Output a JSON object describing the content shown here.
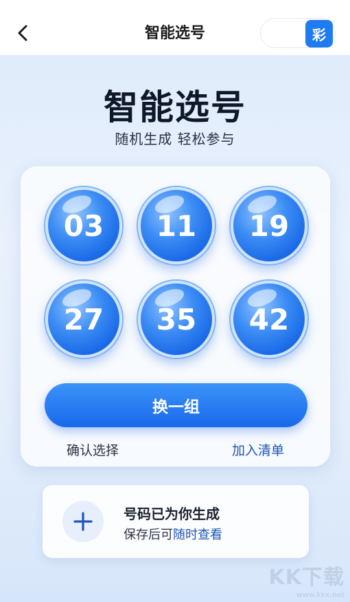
{
  "nav": {
    "title": "智能选号",
    "toggle_label": "彩"
  },
  "hero": {
    "title": "智能选号",
    "subtitle": "随机生成 轻松参与"
  },
  "balls": [
    "03",
    "11",
    "19",
    "27",
    "35",
    "42"
  ],
  "card": {
    "change_label": "换一组",
    "confirm_label": "确认选择",
    "add_label": "加入清单"
  },
  "info": {
    "title": "号码已为你生成",
    "subtitle_prefix": "保存后可",
    "subtitle_highlight": "随时查看"
  },
  "watermark": {
    "logo": "KK下载",
    "url": "www.kkx.net"
  },
  "colors": {
    "accent": "#1f7cf0",
    "link": "#1d56b8"
  }
}
